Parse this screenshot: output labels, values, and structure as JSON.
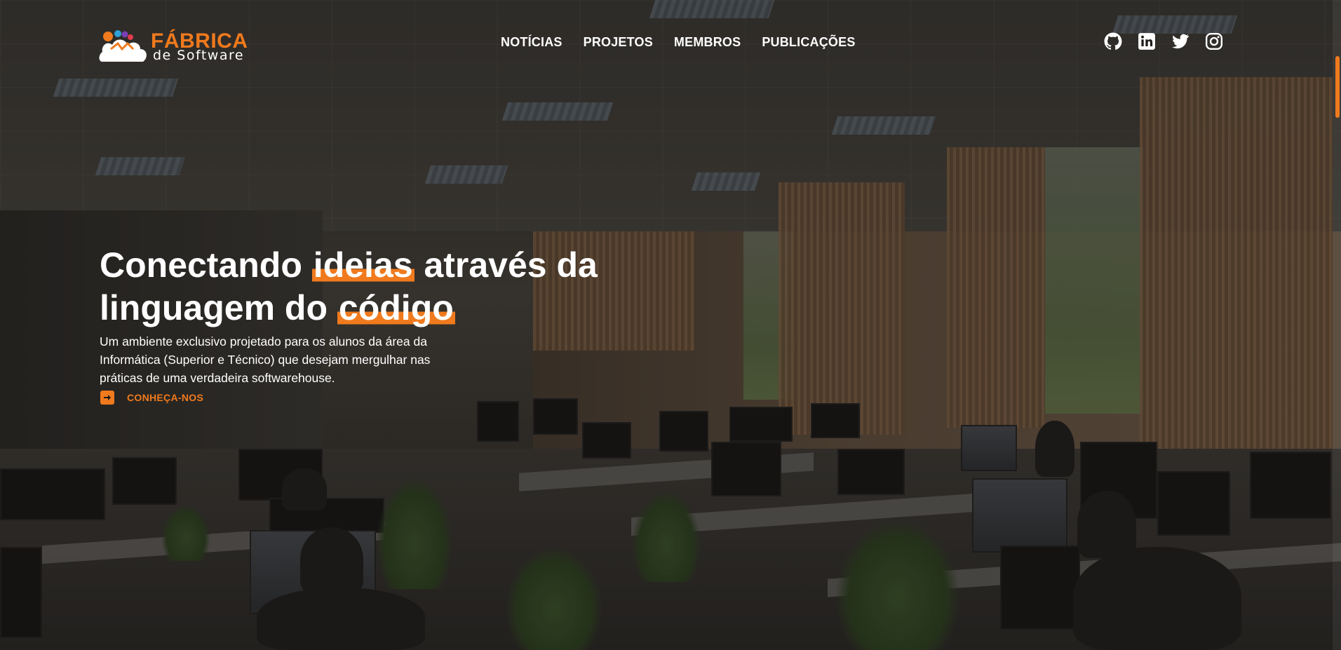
{
  "brand": {
    "title": "FÁBRICA",
    "subtitle": "de Software",
    "accent_color": "#f07a1d",
    "logo_icon": "cloud-logo-icon"
  },
  "nav": {
    "items": [
      {
        "label": "NOTÍCIAS"
      },
      {
        "label": "PROJETOS"
      },
      {
        "label": "MEMBROS"
      },
      {
        "label": "PUBLICAÇÕES"
      }
    ]
  },
  "social": [
    {
      "icon": "github-icon"
    },
    {
      "icon": "linkedin-icon"
    },
    {
      "icon": "twitter-icon"
    },
    {
      "icon": "instagram-icon"
    }
  ],
  "hero": {
    "title_part1": "Conectando ",
    "title_highlight1": "ideias",
    "title_part2": " através da linguagem do ",
    "title_highlight2": "código",
    "description": "Um ambiente exclusivo projetado para os alunos da área da Informática (Superior e Técnico) que desejam mergulhar nas práticas de uma verdadeira softwarehouse.",
    "cta_label": "CONHEÇA-NOS",
    "cta_icon": "arrow-right-box-icon"
  }
}
